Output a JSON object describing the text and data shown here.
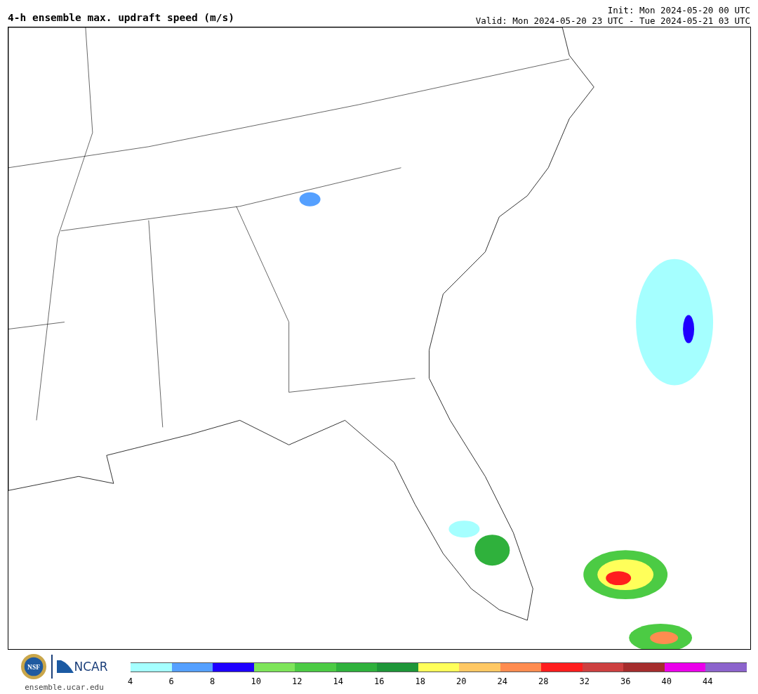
{
  "header": {
    "title": "4-h ensemble max. updraft speed (m/s)",
    "init": "Init: Mon 2024-05-20 00 UTC",
    "valid": "Valid: Mon 2024-05-20 23 UTC - Tue 2024-05-21 03 UTC"
  },
  "footer": {
    "nsf_logo_text": "NSF",
    "ncar_logo_text": "NCAR",
    "site": "ensemble.ucar.edu"
  },
  "legend": [
    {
      "label": "4",
      "color": "#a5ffff"
    },
    {
      "label": "6",
      "color": "#55a0ff"
    },
    {
      "label": "8",
      "color": "#1e00ff"
    },
    {
      "label": "10",
      "color": "#7ee55a"
    },
    {
      "label": "12",
      "color": "#4ccb44"
    },
    {
      "label": "14",
      "color": "#2fb13c"
    },
    {
      "label": "16",
      "color": "#1e9638"
    },
    {
      "label": "18",
      "color": "#ffff5a"
    },
    {
      "label": "20",
      "color": "#ffc864"
    },
    {
      "label": "24",
      "color": "#ff8c50"
    },
    {
      "label": "28",
      "color": "#ff1e1e"
    },
    {
      "label": "32",
      "color": "#cd4040"
    },
    {
      "label": "36",
      "color": "#a52d2d"
    },
    {
      "label": "40",
      "color": "#eb00eb"
    },
    {
      "label": "44",
      "color": "#8c64cc"
    }
  ]
}
